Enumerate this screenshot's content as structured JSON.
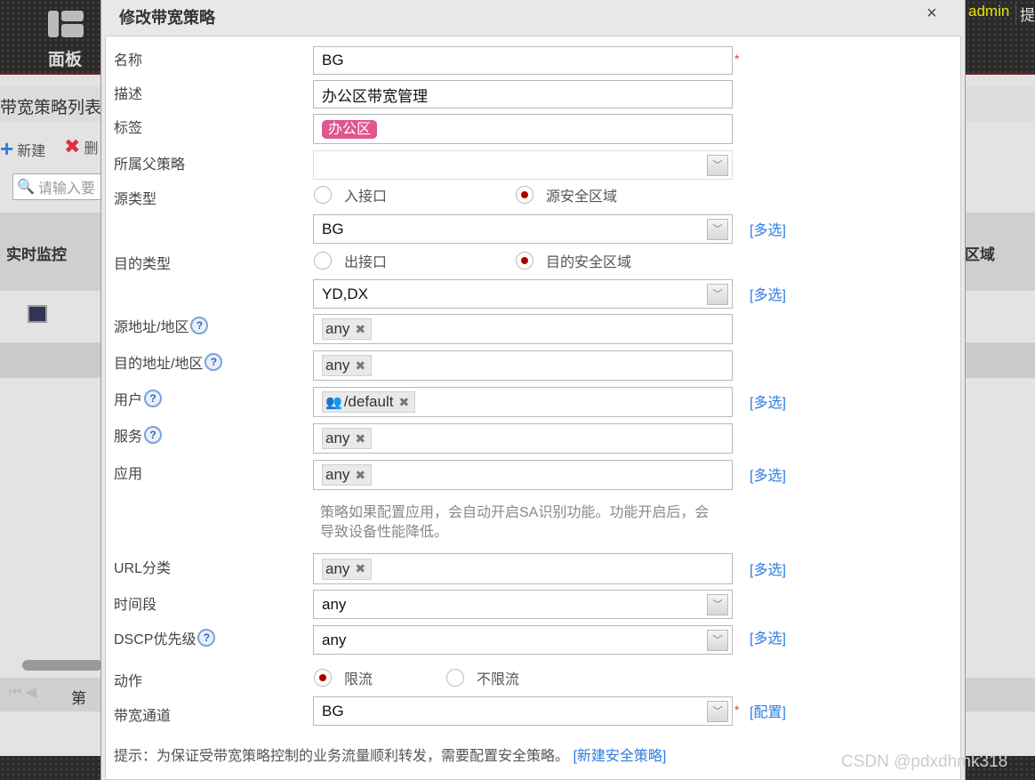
{
  "background": {
    "nav_label": "面板",
    "admin": "admin",
    "admin_next": "提",
    "list_title": "带宽策略列表",
    "new_label": "新建",
    "delete_label": "删",
    "search_placeholder": "请输入要",
    "col_monitor": "实时监控",
    "col_zone": "区域",
    "pager_label": "第"
  },
  "dialog": {
    "title": "修改带宽策略",
    "close": "×",
    "fields": {
      "name": {
        "label": "名称",
        "value": "BG",
        "required": "*"
      },
      "desc": {
        "label": "描述",
        "value": "办公区带宽管理"
      },
      "tag": {
        "label": "标签",
        "value": "办公区"
      },
      "parent": {
        "label": "所属父策略",
        "value": ""
      },
      "src_type": {
        "label": "源类型",
        "opt1": "入接口",
        "opt2": "源安全区域",
        "selected": "源安全区域",
        "value": "BG",
        "multi": "[多选]"
      },
      "dst_type": {
        "label": "目的类型",
        "opt1": "出接口",
        "opt2": "目的安全区域",
        "selected": "目的安全区域",
        "value": "YD,DX",
        "multi": "[多选]"
      },
      "src_addr": {
        "label": "源地址/地区",
        "value": "any"
      },
      "dst_addr": {
        "label": "目的地址/地区",
        "value": "any"
      },
      "user": {
        "label": "用户",
        "value": "/default",
        "multi": "[多选]"
      },
      "service": {
        "label": "服务",
        "value": "any"
      },
      "app": {
        "label": "应用",
        "value": "any",
        "multi": "[多选]",
        "note": "策略如果配置应用，会自动开启SA识别功能。功能开启后，会导致设备性能降低。"
      },
      "url": {
        "label": "URL分类",
        "value": "any",
        "multi": "[多选]"
      },
      "time": {
        "label": "时间段",
        "value": "any"
      },
      "dscp": {
        "label": "DSCP优先级",
        "value": "any",
        "multi": "[多选]"
      },
      "action": {
        "label": "动作",
        "opt1": "限流",
        "opt2": "不限流",
        "selected": "限流"
      },
      "channel": {
        "label": "带宽通道",
        "value": "BG",
        "required": "*",
        "config": "[配置]"
      }
    },
    "hint": "提示：为保证受带宽策略控制的业务流量顺利转发，需要配置安全策略。",
    "hint_link": "[新建安全策略]"
  },
  "watermark": "CSDN @pdxdhmk318"
}
